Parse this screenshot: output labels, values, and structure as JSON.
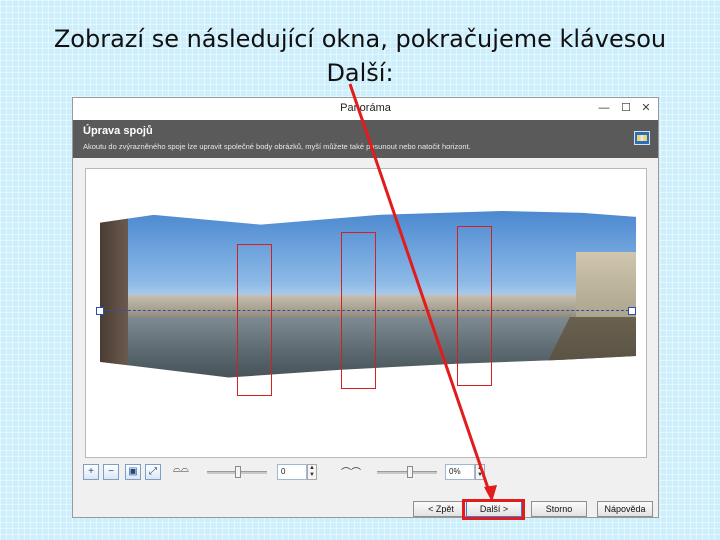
{
  "slide": {
    "title_line1": "Zobrazí se následující okna, pokračujeme klávesou",
    "title_line2": "Další:"
  },
  "window": {
    "title": "Panoráma",
    "controls": {
      "minimize": "—",
      "maximize": "☐",
      "close": "✕"
    }
  },
  "header": {
    "heading": "Úprava spojů",
    "description": "Akoutu do zvýrazněného spoje lze upravit společné body obrázků, myší můžete také posunout nebo natočit horizont."
  },
  "toolbar": {
    "zoom_value": "0",
    "rotation_value": "0%"
  },
  "buttons": {
    "back": "< Zpět",
    "next": "Další >",
    "cancel": "Storno",
    "help": "Nápověda"
  },
  "colors": {
    "highlight": "#e21b1b",
    "arrow": "#e21b1b",
    "header_bg": "#5a5a5a"
  }
}
